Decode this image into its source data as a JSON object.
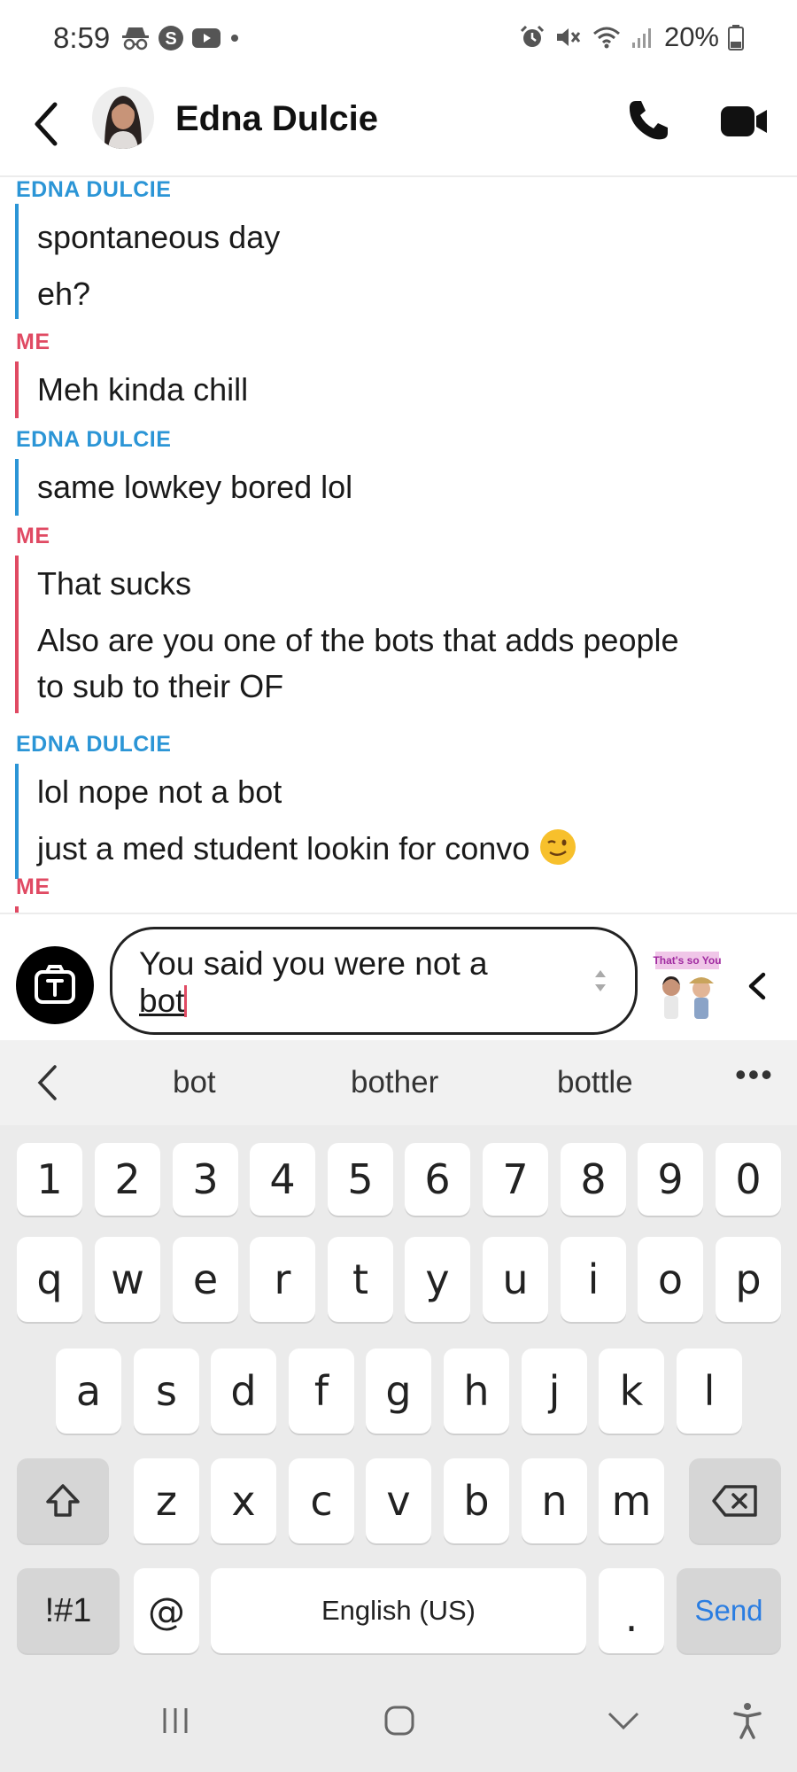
{
  "status_bar": {
    "time": "8:59",
    "battery": "20%"
  },
  "header": {
    "contact_name": "Edna Dulcie"
  },
  "chat": {
    "blocks": [
      {
        "sender": "EDNA DULCIE",
        "messages": [
          "spontaneous day",
          "eh?"
        ]
      },
      {
        "sender": "ME",
        "messages": [
          "Meh kinda chill"
        ]
      },
      {
        "sender": "EDNA DULCIE",
        "messages": [
          "same lowkey bored lol"
        ]
      },
      {
        "sender": "ME",
        "messages": [
          "That sucks",
          "Also are you one of the bots that adds people",
          "to sub to their OF"
        ]
      },
      {
        "sender": "EDNA DULCIE",
        "messages": [
          "lol nope not a bot",
          "just a med student lookin for convo"
        ]
      },
      {
        "sender": "ME",
        "messages": []
      }
    ]
  },
  "composer": {
    "text_line1": "You said you were not a",
    "text_line2": "bot",
    "sticker_text": "That's so You"
  },
  "keyboard": {
    "suggestions": [
      "bot",
      "bother",
      "bottle"
    ],
    "more": "•••",
    "numbers": [
      "1",
      "2",
      "3",
      "4",
      "5",
      "6",
      "7",
      "8",
      "9",
      "0"
    ],
    "row1": [
      "q",
      "w",
      "e",
      "r",
      "t",
      "y",
      "u",
      "i",
      "o",
      "p"
    ],
    "row2": [
      "a",
      "s",
      "d",
      "f",
      "g",
      "h",
      "j",
      "k",
      "l"
    ],
    "row3": [
      "z",
      "x",
      "c",
      "v",
      "b",
      "n",
      "m"
    ],
    "symbols_label": "!#1",
    "at_label": "@",
    "space_label": "English (US)",
    "period_label": ".",
    "send_label": "Send"
  },
  "colors": {
    "edna": "#2b95d6",
    "me": "#e04a63",
    "send": "#2a7de1"
  }
}
